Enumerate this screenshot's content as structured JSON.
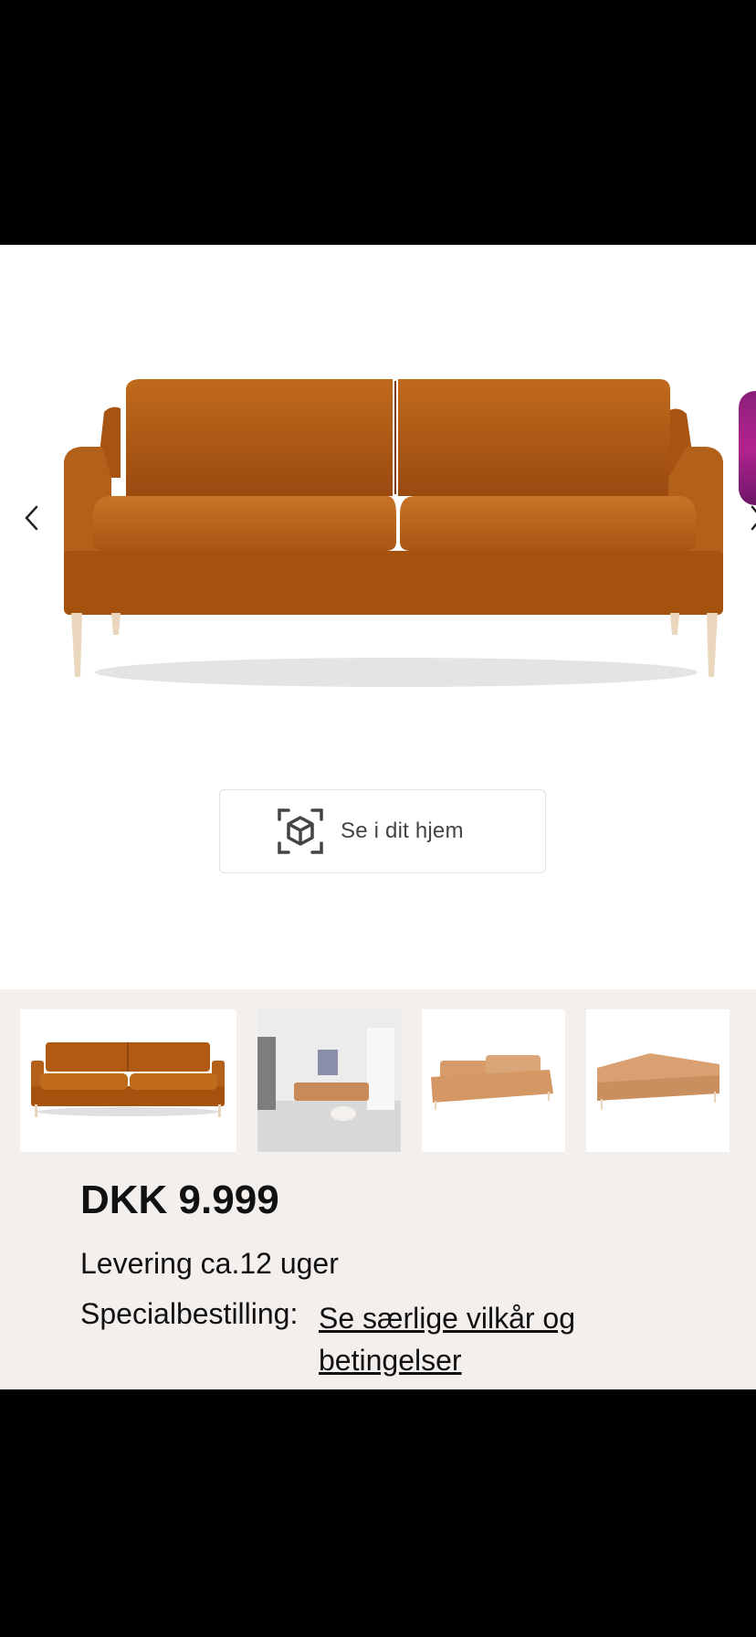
{
  "product": {
    "image_icon": "sofa-image",
    "color": "#b05a14"
  },
  "gallery": {
    "prev_icon": "chevron-left-icon",
    "next_icon": "chevron-right-icon",
    "active_index": 0,
    "thumbnails": [
      "sofa-front-orange",
      "sofa-in-room",
      "sofa-angle-beige",
      "sofa-side-beige"
    ]
  },
  "ar_button": {
    "label": "Se i dit hjem",
    "icon": "ar-cube-icon"
  },
  "pricing": {
    "price": "DKK 9.999",
    "delivery": "Levering ca.12 uger",
    "special_label": "Specialbestilling:",
    "special_link": "Se særlige vilkår og betingelser"
  },
  "colors": {
    "panel_bg": "#f3efed",
    "accent_promo": "#b3238f"
  }
}
